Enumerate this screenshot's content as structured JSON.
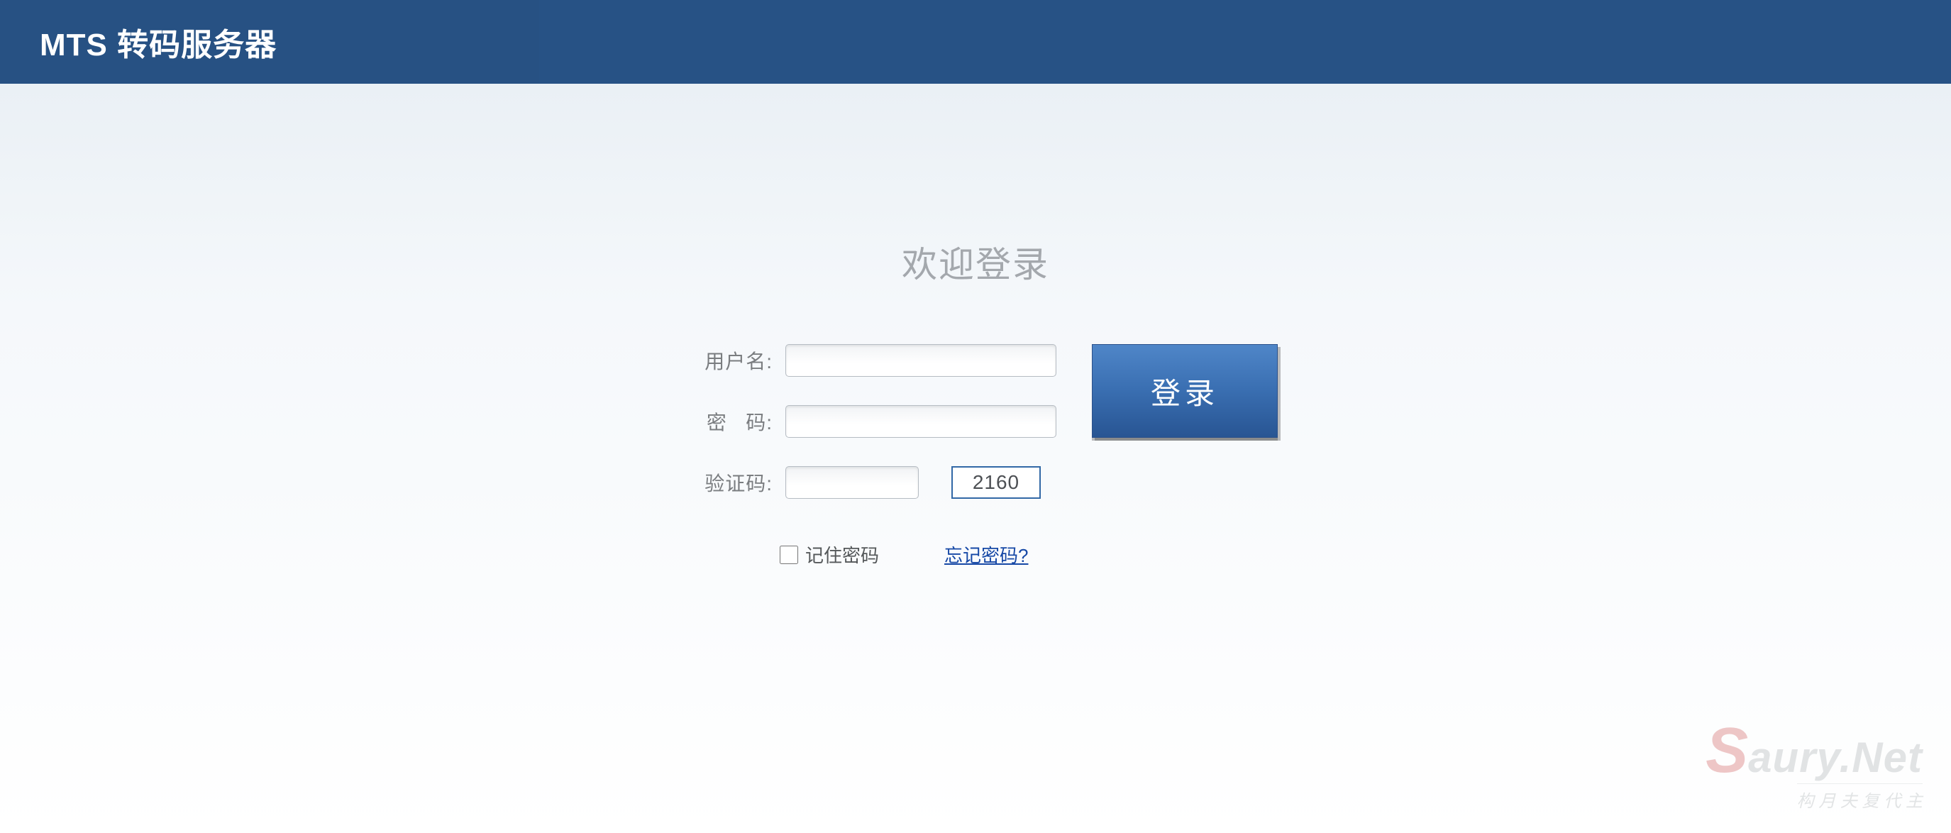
{
  "header": {
    "title": "MTS 转码服务器"
  },
  "login": {
    "title": "欢迎登录",
    "labels": {
      "username": "用户名:",
      "password": "密   码:",
      "captcha": "验证码:"
    },
    "values": {
      "username": "",
      "password": "",
      "captcha": ""
    },
    "captcha_code": "2160",
    "remember_label": "记住密码",
    "forgot_label": "忘记密码?",
    "submit_label": "登录"
  },
  "watermark": {
    "main": "aury.Net",
    "s": "S",
    "sub": "构 月 夫 复 代 主"
  }
}
